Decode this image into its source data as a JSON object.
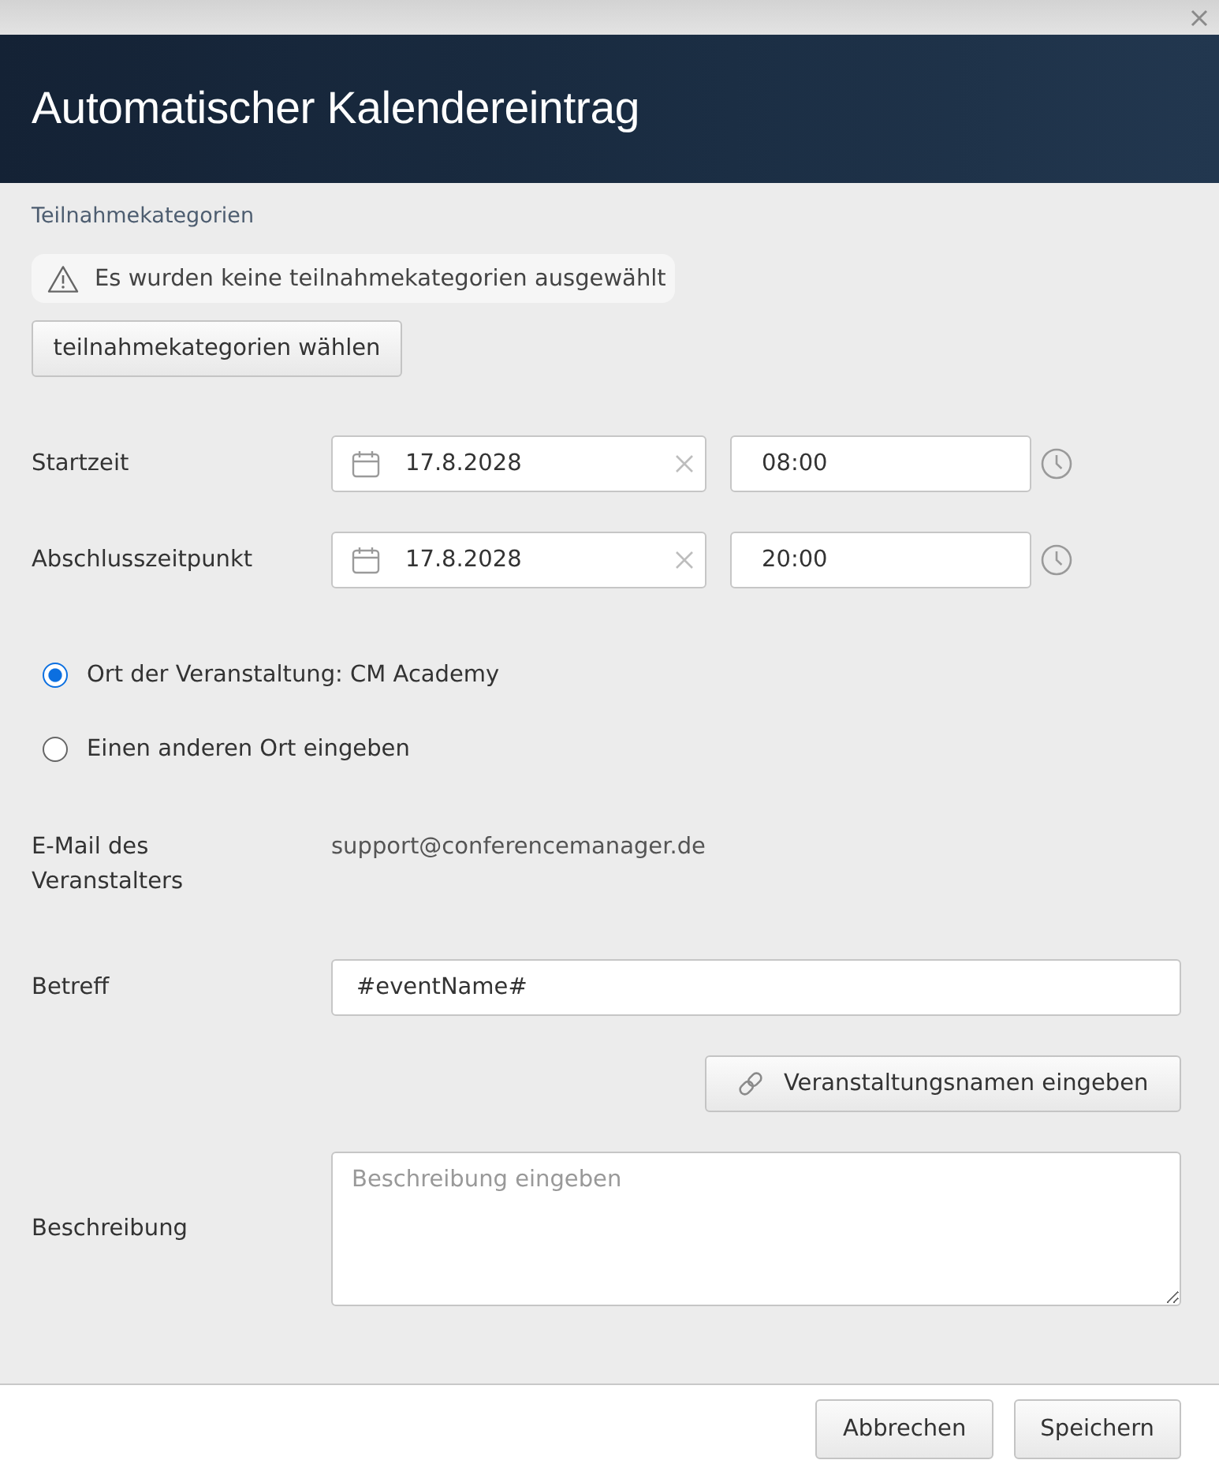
{
  "header": {
    "title": "Automatischer Kalendereintrag"
  },
  "categories": {
    "label": "Teilnahmekategorien",
    "warning": "Es wurden keine teilnahmekategorien ausgewählt",
    "button": "teilnahmekategorien wählen"
  },
  "times": [
    {
      "label": "Startzeit",
      "date": "17.8.2028",
      "time": "08:00"
    },
    {
      "label": "Abschlusszeitpunkt",
      "date": "17.8.2028",
      "time": "20:00"
    }
  ],
  "location_options": [
    {
      "label": "Ort der Veranstaltung: CM Academy",
      "selected": true
    },
    {
      "label": "Einen anderen Ort eingeben",
      "selected": false
    }
  ],
  "organizer_email": {
    "label": "E-Mail des Veranstalters",
    "value": "support@conferencemanager.de"
  },
  "subject": {
    "label": "Betreff",
    "value": "#eventName#",
    "button": "Veranstaltungsnamen eingeben"
  },
  "description": {
    "label": "Beschreibung",
    "placeholder": "Beschreibung eingeben"
  },
  "buttons": [
    "Abbrechen",
    "Speichern"
  ]
}
